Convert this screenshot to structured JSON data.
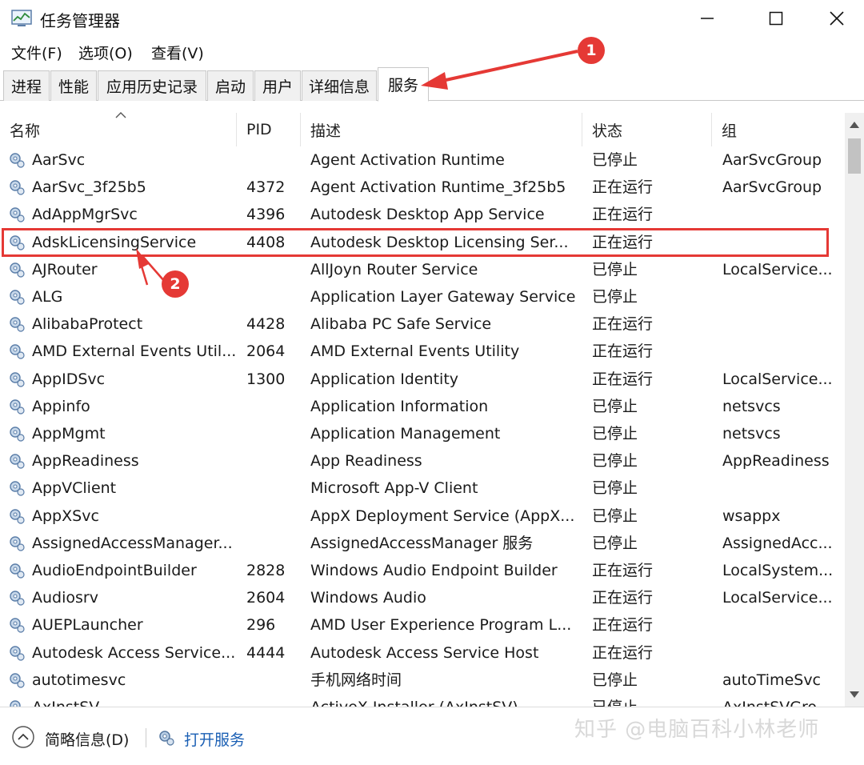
{
  "window": {
    "title": "任务管理器",
    "controls": [
      "minimize-icon",
      "maximize-icon",
      "close-icon"
    ]
  },
  "menu": [
    {
      "label": "文件(F)"
    },
    {
      "label": "选项(O)"
    },
    {
      "label": "查看(V)"
    }
  ],
  "tabs": [
    {
      "label": "进程"
    },
    {
      "label": "性能"
    },
    {
      "label": "应用历史记录"
    },
    {
      "label": "启动"
    },
    {
      "label": "用户"
    },
    {
      "label": "详细信息"
    },
    {
      "label": "服务",
      "active": true
    }
  ],
  "table": {
    "columns": [
      "名称",
      "PID",
      "描述",
      "状态",
      "组"
    ],
    "rows": [
      {
        "name": "AarSvc",
        "pid": "",
        "desc": "Agent Activation Runtime",
        "status": "已停止",
        "group": "AarSvcGroup"
      },
      {
        "name": "AarSvc_3f25b5",
        "pid": "4372",
        "desc": "Agent Activation Runtime_3f25b5",
        "status": "正在运行",
        "group": "AarSvcGroup"
      },
      {
        "name": "AdAppMgrSvc",
        "pid": "4396",
        "desc": "Autodesk Desktop App Service",
        "status": "正在运行",
        "group": ""
      },
      {
        "name": "AdskLicensingService",
        "pid": "4408",
        "desc": "Autodesk Desktop Licensing Ser...",
        "status": "正在运行",
        "group": ""
      },
      {
        "name": "AJRouter",
        "pid": "",
        "desc": "AllJoyn Router Service",
        "status": "已停止",
        "group": "LocalService..."
      },
      {
        "name": "ALG",
        "pid": "",
        "desc": "Application Layer Gateway Service",
        "status": "已停止",
        "group": ""
      },
      {
        "name": "AlibabaProtect",
        "pid": "4428",
        "desc": "Alibaba PC Safe Service",
        "status": "正在运行",
        "group": ""
      },
      {
        "name": "AMD External Events Util...",
        "pid": "2064",
        "desc": "AMD External Events Utility",
        "status": "正在运行",
        "group": ""
      },
      {
        "name": "AppIDSvc",
        "pid": "1300",
        "desc": "Application Identity",
        "status": "正在运行",
        "group": "LocalService..."
      },
      {
        "name": "Appinfo",
        "pid": "",
        "desc": "Application Information",
        "status": "已停止",
        "group": "netsvcs"
      },
      {
        "name": "AppMgmt",
        "pid": "",
        "desc": "Application Management",
        "status": "已停止",
        "group": "netsvcs"
      },
      {
        "name": "AppReadiness",
        "pid": "",
        "desc": "App Readiness",
        "status": "已停止",
        "group": "AppReadiness"
      },
      {
        "name": "AppVClient",
        "pid": "",
        "desc": "Microsoft App-V Client",
        "status": "已停止",
        "group": ""
      },
      {
        "name": "AppXSvc",
        "pid": "",
        "desc": "AppX Deployment Service (AppX...",
        "status": "已停止",
        "group": "wsappx"
      },
      {
        "name": "AssignedAccessManager...",
        "pid": "",
        "desc": "AssignedAccessManager 服务",
        "status": "已停止",
        "group": "AssignedAcc..."
      },
      {
        "name": "AudioEndpointBuilder",
        "pid": "2828",
        "desc": "Windows Audio Endpoint Builder",
        "status": "正在运行",
        "group": "LocalSystem..."
      },
      {
        "name": "Audiosrv",
        "pid": "2604",
        "desc": "Windows Audio",
        "status": "正在运行",
        "group": "LocalService..."
      },
      {
        "name": "AUEPLauncher",
        "pid": "296",
        "desc": "AMD User Experience Program L...",
        "status": "正在运行",
        "group": ""
      },
      {
        "name": "Autodesk Access Service...",
        "pid": "4444",
        "desc": "Autodesk Access Service Host",
        "status": "正在运行",
        "group": ""
      },
      {
        "name": "autotimesvc",
        "pid": "",
        "desc": "手机网络时间",
        "status": "已停止",
        "group": "autoTimeSvc"
      },
      {
        "name": "AxInstSV",
        "pid": "",
        "desc": "ActiveX Installer (AxInstSV)",
        "status": "已停止",
        "group": "AxInstSVGro..."
      }
    ]
  },
  "footer": {
    "brief_label": "简略信息(D)",
    "open_services_label": "打开服务"
  },
  "annotations": {
    "badge1": "1",
    "badge2": "2",
    "watermark": "知乎 @电脑百科小林老师",
    "accent": "#e53935"
  }
}
